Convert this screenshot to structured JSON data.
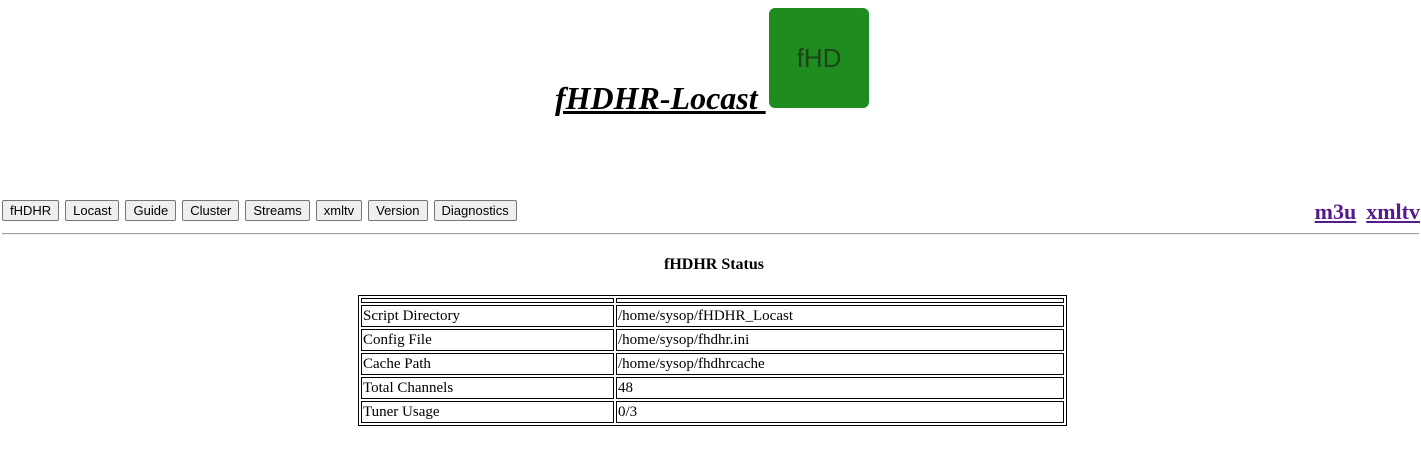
{
  "header": {
    "title": "fHDHR-Locast ",
    "logo_text": "fHD",
    "logo_color": "#1e8c1e"
  },
  "nav": {
    "buttons": [
      "fHDHR",
      "Locast",
      "Guide",
      "Cluster",
      "Streams",
      "xmltv",
      "Version",
      "Diagnostics"
    ],
    "links": [
      "m3u",
      "xmltv"
    ]
  },
  "status": {
    "title": "fHDHR Status",
    "rows": [
      {
        "label": "Script Directory",
        "value": "/home/sysop/fHDHR_Locast"
      },
      {
        "label": "Config File",
        "value": "/home/sysop/fhdhr.ini"
      },
      {
        "label": "Cache Path",
        "value": "/home/sysop/fhdhrcache"
      },
      {
        "label": "Total Channels",
        "value": "48"
      },
      {
        "label": "Tuner Usage",
        "value": "0/3"
      }
    ]
  },
  "colors": {
    "link_visited": "#551a8b",
    "button_bg": "#efefef"
  }
}
